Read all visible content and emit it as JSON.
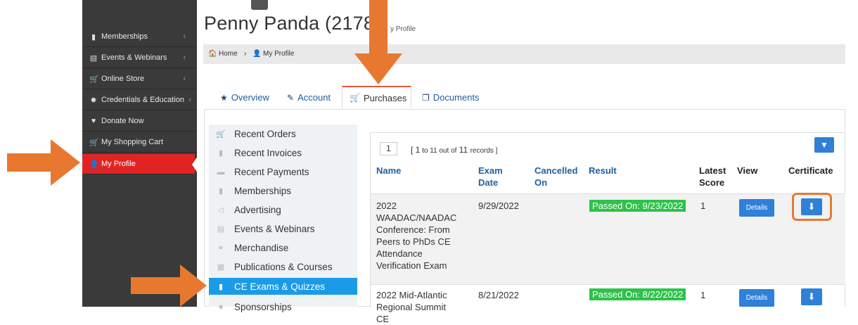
{
  "sidebar": {
    "items": [
      {
        "label": "Memberships",
        "icon": "bookmark-icon",
        "glyph": "▮",
        "chevron": true,
        "active": false
      },
      {
        "label": "Events & Webinars",
        "icon": "calendar-icon",
        "glyph": "▤",
        "chevron": true,
        "active": false
      },
      {
        "label": "Online Store",
        "icon": "cart-icon",
        "glyph": "🛒",
        "chevron": true,
        "active": false
      },
      {
        "label": "Credentials & Education",
        "icon": "certificate-icon",
        "glyph": "✹",
        "chevron": true,
        "active": false
      },
      {
        "label": "Donate Now",
        "icon": "heart-icon",
        "glyph": "♥",
        "chevron": false,
        "active": false
      },
      {
        "label": "My Shopping Cart",
        "icon": "cart-icon",
        "glyph": "🛒",
        "chevron": false,
        "active": false
      },
      {
        "label": "My Profile",
        "icon": "user-icon",
        "glyph": "👤",
        "chevron": false,
        "active": true
      }
    ],
    "chevron_glyph": "‹",
    "active_color": "#e02424",
    "bg_color": "#3a3a3a"
  },
  "header": {
    "title": "Penny Panda (21788",
    "subtitle": "y Profile"
  },
  "breadcrumb": {
    "home_icon": "home-icon",
    "home_glyph": "🏠",
    "home_label": "Home",
    "separator": "›",
    "user_glyph": "👤",
    "current_label": "My Profile"
  },
  "tabs": [
    {
      "label": "Overview",
      "icon": "star-icon",
      "glyph": "★",
      "active": false
    },
    {
      "label": "Account",
      "icon": "edit-icon",
      "glyph": "✎",
      "active": false
    },
    {
      "label": "Purchases",
      "icon": "cart-icon",
      "glyph": "🛒",
      "active": true
    },
    {
      "label": "Documents",
      "icon": "copy-icon",
      "glyph": "❐",
      "active": false
    }
  ],
  "purchase_menu": [
    {
      "label": "Recent Orders",
      "icon": "cart-icon",
      "glyph": "🛒",
      "active": false
    },
    {
      "label": "Recent Invoices",
      "icon": "file-icon",
      "glyph": "▮",
      "active": false
    },
    {
      "label": "Recent Payments",
      "icon": "money-icon",
      "glyph": "▬",
      "active": false
    },
    {
      "label": "Memberships",
      "icon": "bookmark-icon",
      "glyph": "▮",
      "active": false
    },
    {
      "label": "Advertising",
      "icon": "bullhorn-icon",
      "glyph": "◁",
      "active": false
    },
    {
      "label": "Events & Webinars",
      "icon": "calendar-icon",
      "glyph": "▤",
      "active": false
    },
    {
      "label": "Merchandise",
      "icon": "tags-icon",
      "glyph": "⚭",
      "active": false
    },
    {
      "label": "Publications & Courses",
      "icon": "book-icon",
      "glyph": "▦",
      "active": false
    },
    {
      "label": "CE Exams & Quizzes",
      "icon": "file-text-icon",
      "glyph": "▮",
      "active": true
    },
    {
      "label": "Sponsorships",
      "icon": "star-icon",
      "glyph": "★",
      "active": false
    }
  ],
  "table": {
    "page": "1",
    "records_prefix": "[ 1",
    "records_mid": " to 11 ",
    "records_out": "out of",
    "records_count": " 11 ",
    "records_suffix": "records ]",
    "filter_icon": "filter-icon",
    "filter_glyph": "▼",
    "headers": {
      "name": "Name",
      "exam_date": "Exam Date",
      "cancelled_on": "Cancelled On",
      "result": "Result",
      "latest_score": "Latest Score",
      "view": "View",
      "certificate": "Certificate"
    },
    "rows": [
      {
        "name": "2022 WAADAC/NAADAC Conference: From Peers to PhDs CE Attendance Verification Exam",
        "exam_date": "9/29/2022",
        "cancelled_on": "",
        "result": "Passed On: 9/23/2022",
        "latest_score": "1",
        "view": "Details",
        "download_glyph": "⬇"
      },
      {
        "name": "2022 Mid-Atlantic Regional Summit CE",
        "exam_date": "8/21/2022",
        "cancelled_on": "",
        "result": "Passed On: 8/22/2022",
        "latest_score": "1",
        "view": "Details",
        "download_glyph": "⬇"
      }
    ],
    "passed_color": "#2ec24a",
    "button_color": "#2f80d8"
  },
  "annotations": {
    "arrow_color": "#e8782f"
  }
}
